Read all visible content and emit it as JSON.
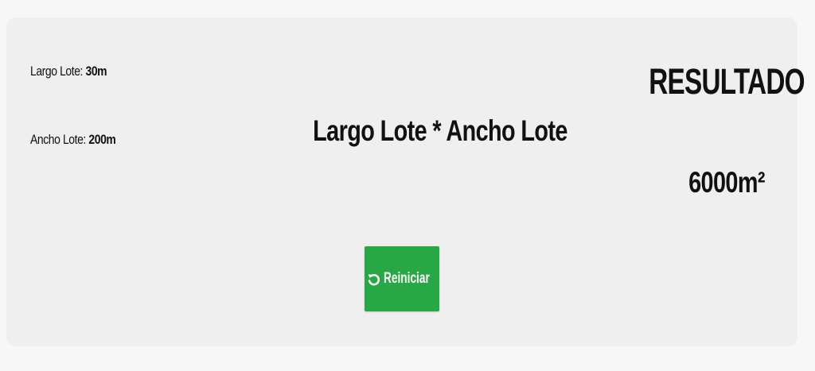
{
  "inputs": {
    "largo_label": "Largo Lote:",
    "largo_value": "30m",
    "ancho_label": "Ancho Lote:",
    "ancho_value": "200m"
  },
  "formula": "Largo Lote * Ancho Lote",
  "result": {
    "title": "RESULTADO",
    "value": "6000m²"
  },
  "button": {
    "label": "Reiniciar",
    "icon": "rotate-ccw-icon",
    "color": "#28a745"
  },
  "colors": {
    "page_bg": "#f7f7f7",
    "panel_bg": "#efefef"
  }
}
